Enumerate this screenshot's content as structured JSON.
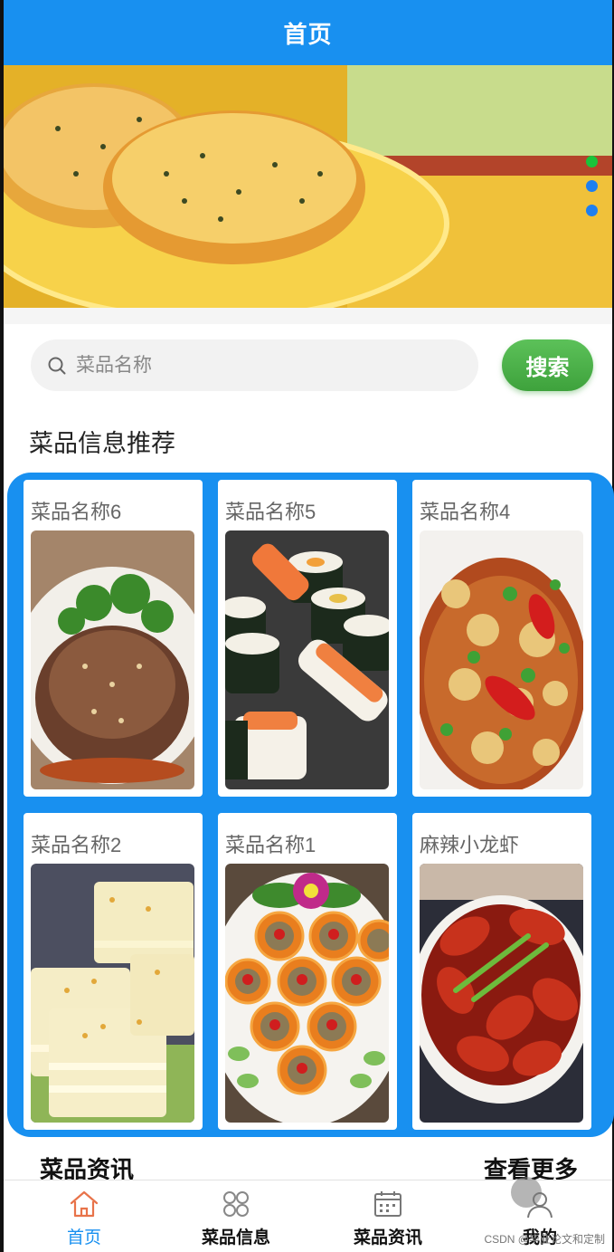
{
  "header": {
    "title": "首页"
  },
  "banner": {
    "dots": 3,
    "active_dot": 0
  },
  "search": {
    "placeholder": "菜品名称",
    "button_label": "搜索"
  },
  "recommend": {
    "title": "菜品信息推荐",
    "items": [
      {
        "name": "菜品名称6"
      },
      {
        "name": "菜品名称5"
      },
      {
        "name": "菜品名称4"
      },
      {
        "name": "菜品名称2"
      },
      {
        "name": "菜品名称1"
      },
      {
        "name": "麻辣小龙虾"
      }
    ]
  },
  "news": {
    "title": "菜品资讯",
    "more_label": "查看更多"
  },
  "tabbar": {
    "items": [
      {
        "label": "首页",
        "icon": "home-icon"
      },
      {
        "label": "菜品信息",
        "icon": "grid-icon"
      },
      {
        "label": "菜品资讯",
        "icon": "calendar-icon"
      },
      {
        "label": "我的",
        "icon": "user-icon"
      }
    ]
  },
  "watermark": "CSDN @毕业论文和定制",
  "colors": {
    "primary": "#1890f0",
    "search_button": "#4cb349",
    "active_dot": "#19c43a"
  }
}
